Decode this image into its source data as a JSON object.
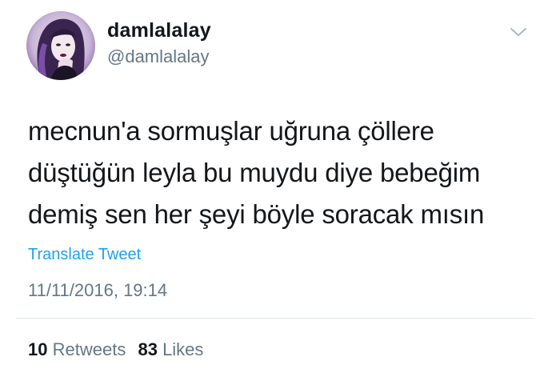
{
  "user": {
    "display_name": "damlalalay",
    "handle": "@damlalalay"
  },
  "tweet": {
    "text": "mecnun'a sormuşlar uğruna çöllere\ndüştüğün leyla bu muydu diye bebeğim\ndemiş sen her şeyi böyle soracak mısın",
    "translate_label": "Translate Tweet",
    "timestamp": "11/11/2016, 19:14"
  },
  "stats": {
    "retweets_count": "10",
    "retweets_label": "Retweets",
    "likes_count": "83",
    "likes_label": "Likes"
  },
  "icons": {
    "menu": "chevron-down-icon"
  },
  "colors": {
    "link": "#1da1f2",
    "secondary_text": "#657786",
    "primary_text": "#14171a",
    "divider": "#e1e8ed"
  }
}
